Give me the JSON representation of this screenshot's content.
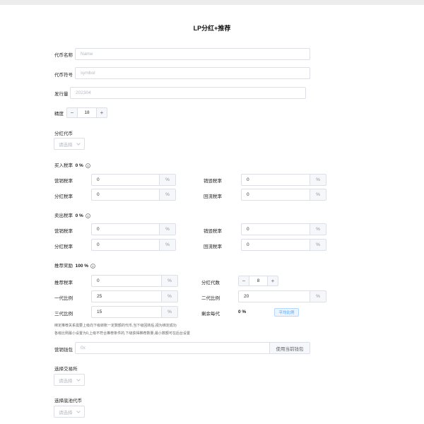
{
  "title": "LP分红+推荐",
  "token": {
    "name_label": "代币名称",
    "name_placeholder": "Name",
    "symbol_label": "代币符号",
    "symbol_placeholder": "symbol",
    "supply_label": "发行量",
    "supply_placeholder": "202304",
    "precision_label": "精度",
    "precision_value": "18"
  },
  "dividend": {
    "label": "分红代币",
    "select_placeholder": "请选择"
  },
  "buy": {
    "label": "买入税率",
    "total": "0 %",
    "marketing_label": "营销税率",
    "marketing_value": "0",
    "burn_label": "销毁税率",
    "burn_value": "0",
    "dividend_label": "分红税率",
    "dividend_value": "0",
    "lp_label": "回流税率",
    "lp_value": "0"
  },
  "sell": {
    "label": "卖出税率",
    "total": "0 %",
    "marketing_label": "营销税率",
    "marketing_value": "0",
    "burn_label": "销毁税率",
    "burn_value": "0",
    "dividend_label": "分红税率",
    "dividend_value": "0",
    "lp_label": "回流税率",
    "lp_value": "0"
  },
  "referral": {
    "label": "推荐奖励",
    "total": "100 %",
    "tax_label": "推荐税率",
    "tax_value": "0",
    "generations_label": "分红代数",
    "generations_value": "8",
    "gen1_label": "一代比例",
    "gen1_value": "25",
    "gen2_label": "二代比例",
    "gen2_value": "20",
    "gen3_label": "三代比例",
    "gen3_value": "15",
    "remaining_label": "剩余每代",
    "remaining_value": "0 %",
    "avg_button": "平均比例",
    "note1": "绑定推荐关系需要上级向下级转账一定数额的代币,当下级回转后,视为绑定成功",
    "note2": "各级比例最小设置为0,上级不符合推荐条件的,下级获得推荐数量,最小数额可在后台设置"
  },
  "marketing_wallet": {
    "label": "营销钱包",
    "placeholder": "0x",
    "button": "使用当前钱包"
  },
  "exchange": {
    "label": "选择交易所",
    "placeholder": "请选择"
  },
  "pool_token": {
    "label": "选择底池代币",
    "placeholder": "请选择"
  },
  "percent_unit": "%",
  "colors": {
    "accent": "#409eff",
    "border": "#dcdfe6",
    "addon_bg": "#f5f7fa"
  }
}
